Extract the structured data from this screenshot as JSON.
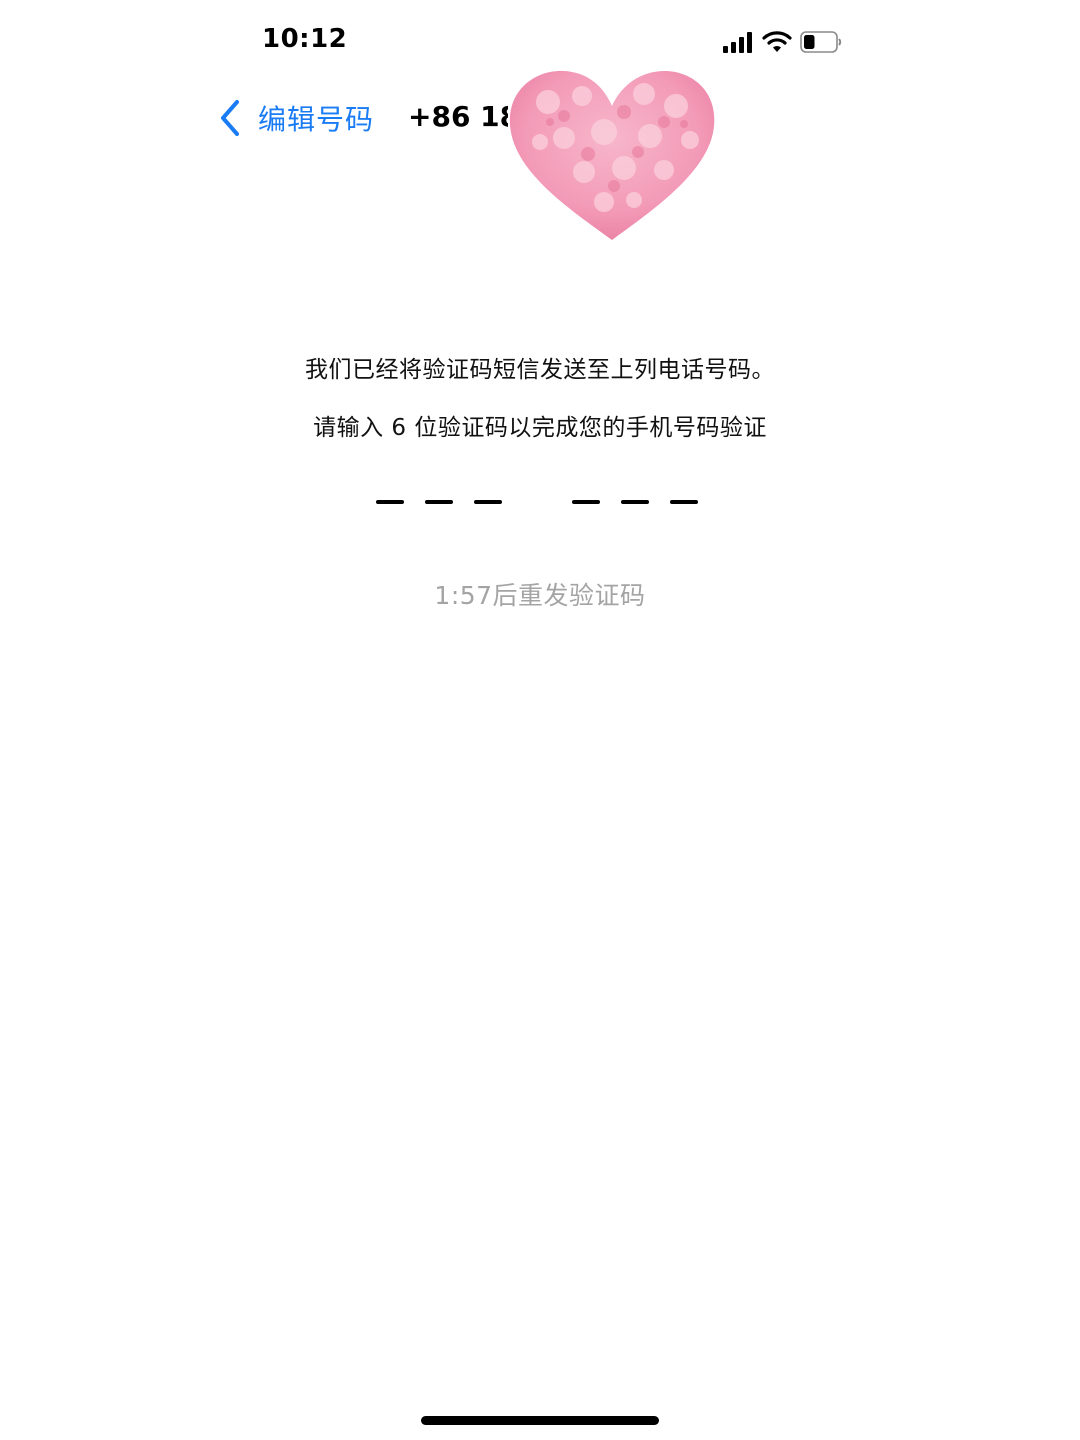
{
  "status_bar": {
    "time": "10:12",
    "icons": [
      "signal-icon",
      "wifi-icon",
      "battery-icon"
    ],
    "battery_level": 0.35
  },
  "nav": {
    "back_label": "编辑号码",
    "back_icon": "chevron-left-icon",
    "phone_visible": "+86 18",
    "accent_color": "#1a7cf5"
  },
  "overlay": {
    "sticker": "pink-heart-sticker",
    "color": "#f5a9c3"
  },
  "message": {
    "line1": "我们已经将验证码短信发送至上列电话号码。",
    "line2": "请输入 6 位验证码以完成您的手机号码验证"
  },
  "code": {
    "length": 6,
    "entered": ""
  },
  "resend": {
    "text": "1:57后重发验证码",
    "color": "#a4a4a4"
  }
}
